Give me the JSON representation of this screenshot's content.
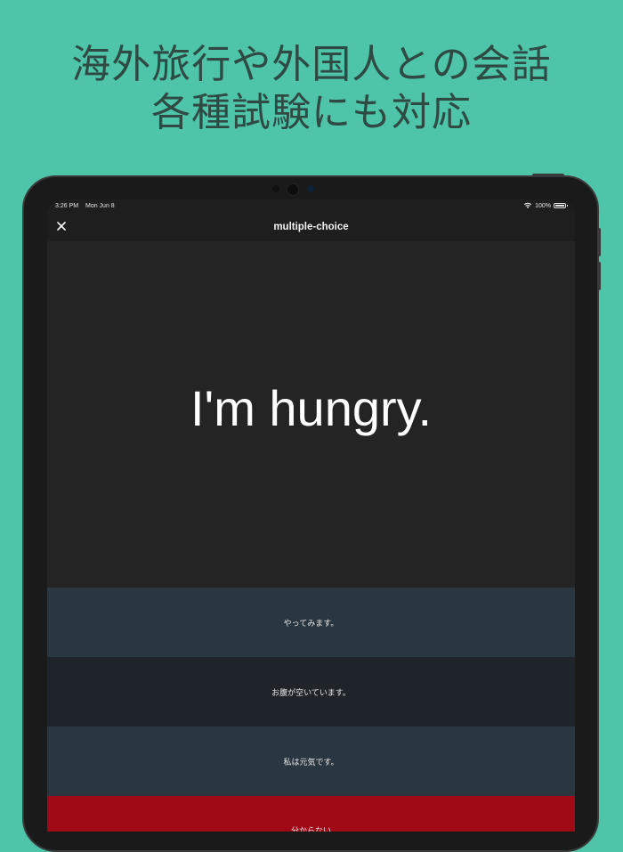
{
  "headline": {
    "line1": "海外旅行や外国人との会話",
    "line2": "各種試験にも対応"
  },
  "status_bar": {
    "time": "3:26 PM",
    "date": "Mon Jun 8",
    "battery": "100%",
    "icons": [
      "wifi-icon",
      "battery-icon"
    ]
  },
  "nav": {
    "title": "multiple-choice",
    "close_icon": "close-icon"
  },
  "question": {
    "text": "I'm hungry."
  },
  "choices": [
    {
      "label": "やってみます。"
    },
    {
      "label": "お腹が空いています。"
    },
    {
      "label": "私は元気です。"
    },
    {
      "label": "分からない"
    }
  ],
  "colors": {
    "background": "#4ec4a8",
    "headline": "#2f4a44",
    "screen": "#242424",
    "choice_light": "#2b3740",
    "choice_dark": "#1f242a",
    "choice_unknown": "#a00a17"
  }
}
